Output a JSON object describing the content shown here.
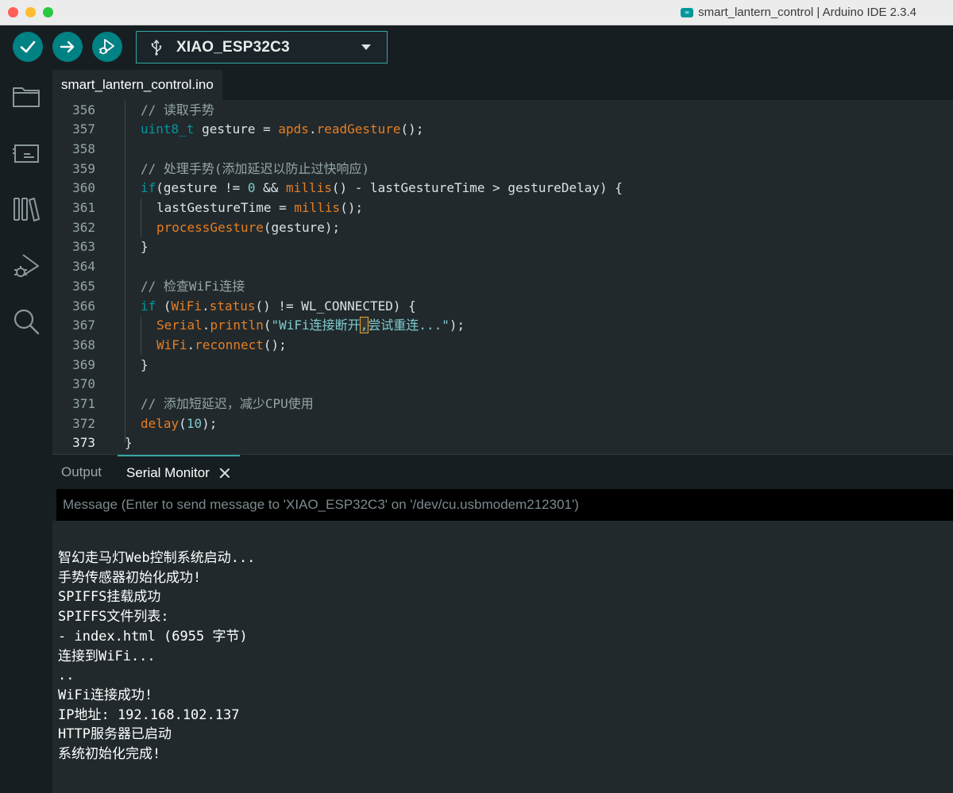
{
  "window": {
    "title": "smart_lantern_control | Arduino IDE 2.3.4",
    "app_badge": "∞"
  },
  "toolbar": {
    "verify_icon": "checkmark-icon",
    "upload_icon": "arrow-right-icon",
    "debug_icon": "debug-icon",
    "board": "XIAO_ESP32C3",
    "accent": "#008184"
  },
  "activity_bar": {
    "icons": [
      "folder-icon",
      "board-manager-icon",
      "library-icon",
      "debug-icon",
      "search-icon"
    ]
  },
  "editor": {
    "file_tab": "smart_lantern_control.ino",
    "lines": [
      {
        "num": "356",
        "indent": 1,
        "tokens": [
          {
            "t": "// 读取手势",
            "c": "c"
          }
        ]
      },
      {
        "num": "357",
        "indent": 1,
        "tokens": [
          {
            "t": "uint8_t",
            "c": "t"
          },
          {
            "t": " gesture = ",
            "c": ""
          },
          {
            "t": "apds",
            "c": "f"
          },
          {
            "t": ".",
            "c": ""
          },
          {
            "t": "readGesture",
            "c": "f"
          },
          {
            "t": "();",
            "c": ""
          }
        ]
      },
      {
        "num": "358",
        "indent": 1,
        "tokens": []
      },
      {
        "num": "359",
        "indent": 1,
        "tokens": [
          {
            "t": "// 处理手势(添加延迟以防止过快响应)",
            "c": "c"
          }
        ]
      },
      {
        "num": "360",
        "indent": 1,
        "tokens": [
          {
            "t": "if",
            "c": "k"
          },
          {
            "t": "(gesture != ",
            "c": ""
          },
          {
            "t": "0",
            "c": "n"
          },
          {
            "t": " && ",
            "c": ""
          },
          {
            "t": "millis",
            "c": "f"
          },
          {
            "t": "() - lastGestureTime > gestureDelay) {",
            "c": ""
          }
        ]
      },
      {
        "num": "361",
        "indent": 2,
        "tokens": [
          {
            "t": "lastGestureTime = ",
            "c": ""
          },
          {
            "t": "millis",
            "c": "f"
          },
          {
            "t": "();",
            "c": ""
          }
        ]
      },
      {
        "num": "362",
        "indent": 2,
        "tokens": [
          {
            "t": "processGesture",
            "c": "f"
          },
          {
            "t": "(gesture);",
            "c": ""
          }
        ]
      },
      {
        "num": "363",
        "indent": 1,
        "tokens": [
          {
            "t": "}",
            "c": ""
          }
        ]
      },
      {
        "num": "364",
        "indent": 1,
        "tokens": []
      },
      {
        "num": "365",
        "indent": 1,
        "tokens": [
          {
            "t": "// 检查WiFi连接",
            "c": "c"
          }
        ]
      },
      {
        "num": "366",
        "indent": 1,
        "tokens": [
          {
            "t": "if",
            "c": "k"
          },
          {
            "t": " (",
            "c": ""
          },
          {
            "t": "WiFi",
            "c": "f"
          },
          {
            "t": ".",
            "c": ""
          },
          {
            "t": "status",
            "c": "f"
          },
          {
            "t": "() != WL_CONNECTED) {",
            "c": ""
          }
        ]
      },
      {
        "num": "367",
        "indent": 2,
        "tokens": [
          {
            "t": "Serial",
            "c": "f"
          },
          {
            "t": ".",
            "c": ""
          },
          {
            "t": "println",
            "c": "f"
          },
          {
            "t": "(",
            "c": ""
          },
          {
            "t": "\"WiFi连接断开",
            "c": "s"
          },
          {
            "t": ",",
            "c": "s hl"
          },
          {
            "t": "尝试重连...\"",
            "c": "s"
          },
          {
            "t": ");",
            "c": ""
          }
        ]
      },
      {
        "num": "368",
        "indent": 2,
        "tokens": [
          {
            "t": "WiFi",
            "c": "f"
          },
          {
            "t": ".",
            "c": ""
          },
          {
            "t": "reconnect",
            "c": "f"
          },
          {
            "t": "();",
            "c": ""
          }
        ]
      },
      {
        "num": "369",
        "indent": 1,
        "tokens": [
          {
            "t": "}",
            "c": ""
          }
        ]
      },
      {
        "num": "370",
        "indent": 1,
        "tokens": []
      },
      {
        "num": "371",
        "indent": 1,
        "tokens": [
          {
            "t": "// 添加短延迟，减少CPU使用",
            "c": "c"
          }
        ]
      },
      {
        "num": "372",
        "indent": 1,
        "tokens": [
          {
            "t": "delay",
            "c": "f"
          },
          {
            "t": "(",
            "c": ""
          },
          {
            "t": "10",
            "c": "n"
          },
          {
            "t": ");",
            "c": ""
          }
        ]
      },
      {
        "num": "373",
        "indent": 0,
        "current": true,
        "tokens": [
          {
            "t": "}",
            "c": ""
          }
        ]
      }
    ]
  },
  "panel": {
    "tabs": {
      "output": "Output",
      "serial": "Serial Monitor"
    },
    "message_placeholder": "Message (Enter to send message to 'XIAO_ESP32C3' on '/dev/cu.usbmodem212301')",
    "serial_lines": [
      "智幻走马灯Web控制系统启动...",
      "手势传感器初始化成功!",
      "SPIFFS挂载成功",
      "SPIFFS文件列表:",
      "- index.html (6955 字节)",
      "连接到WiFi...",
      "..",
      "WiFi连接成功!",
      "IP地址: 192.168.102.137",
      "HTTP服务器已启动",
      "系统初始化完成!"
    ]
  }
}
